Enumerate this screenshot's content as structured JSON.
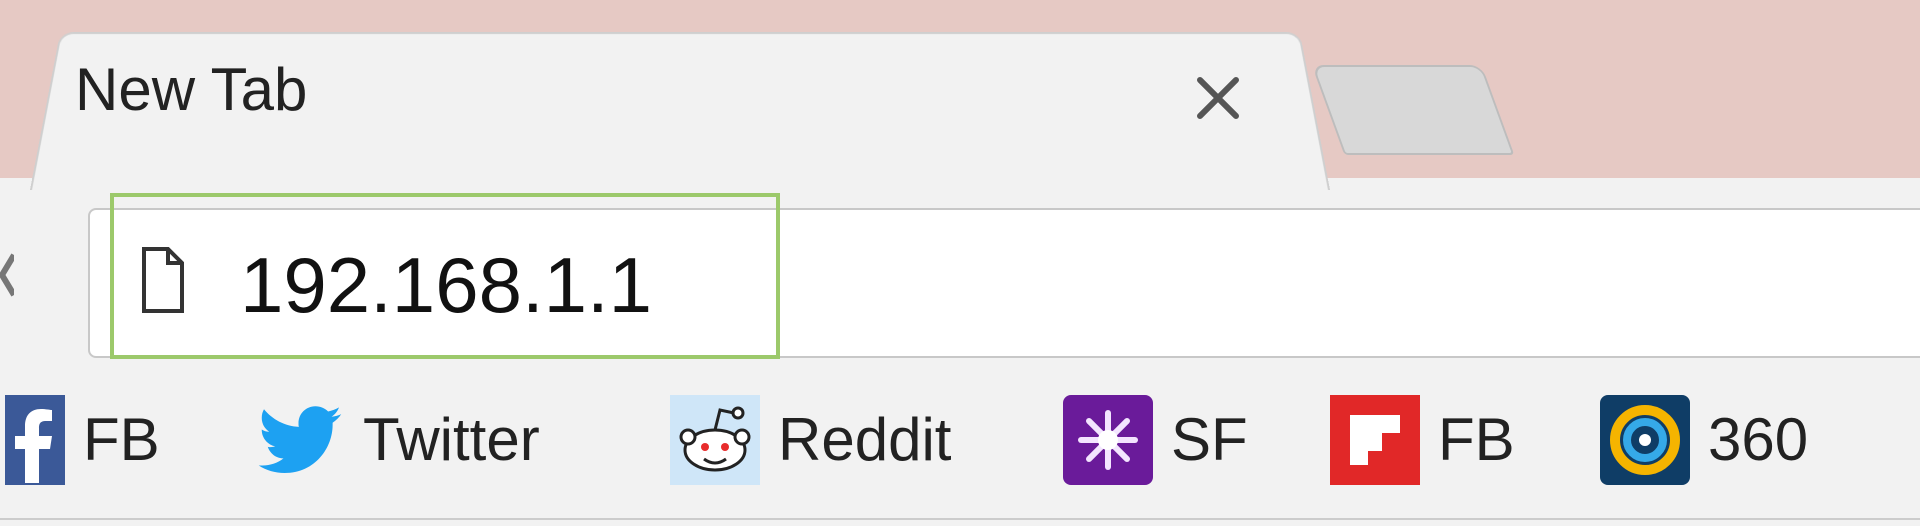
{
  "tabs": [
    {
      "title": "New Tab",
      "active": true
    }
  ],
  "address_bar": {
    "url": "192.168.1.1",
    "icon": "page-icon"
  },
  "bookmarks": [
    {
      "label": "FB",
      "icon": "facebook-icon",
      "color": "#3b5998"
    },
    {
      "label": "Twitter",
      "icon": "twitter-icon",
      "color": "#1da1f2"
    },
    {
      "label": "Reddit",
      "icon": "reddit-icon",
      "color": "#cfe6f8"
    },
    {
      "label": "SF",
      "icon": "sf-icon",
      "color": "#6a1b9a"
    },
    {
      "label": "FB",
      "icon": "flipboard-icon",
      "color": "#e12828"
    },
    {
      "label": "360",
      "icon": "360-icon",
      "color": "#0f3d66"
    }
  ],
  "colors": {
    "titlebar": "#e6c9c4",
    "highlight": "#9cc96b",
    "chrome_bg": "#f2f2f2"
  }
}
